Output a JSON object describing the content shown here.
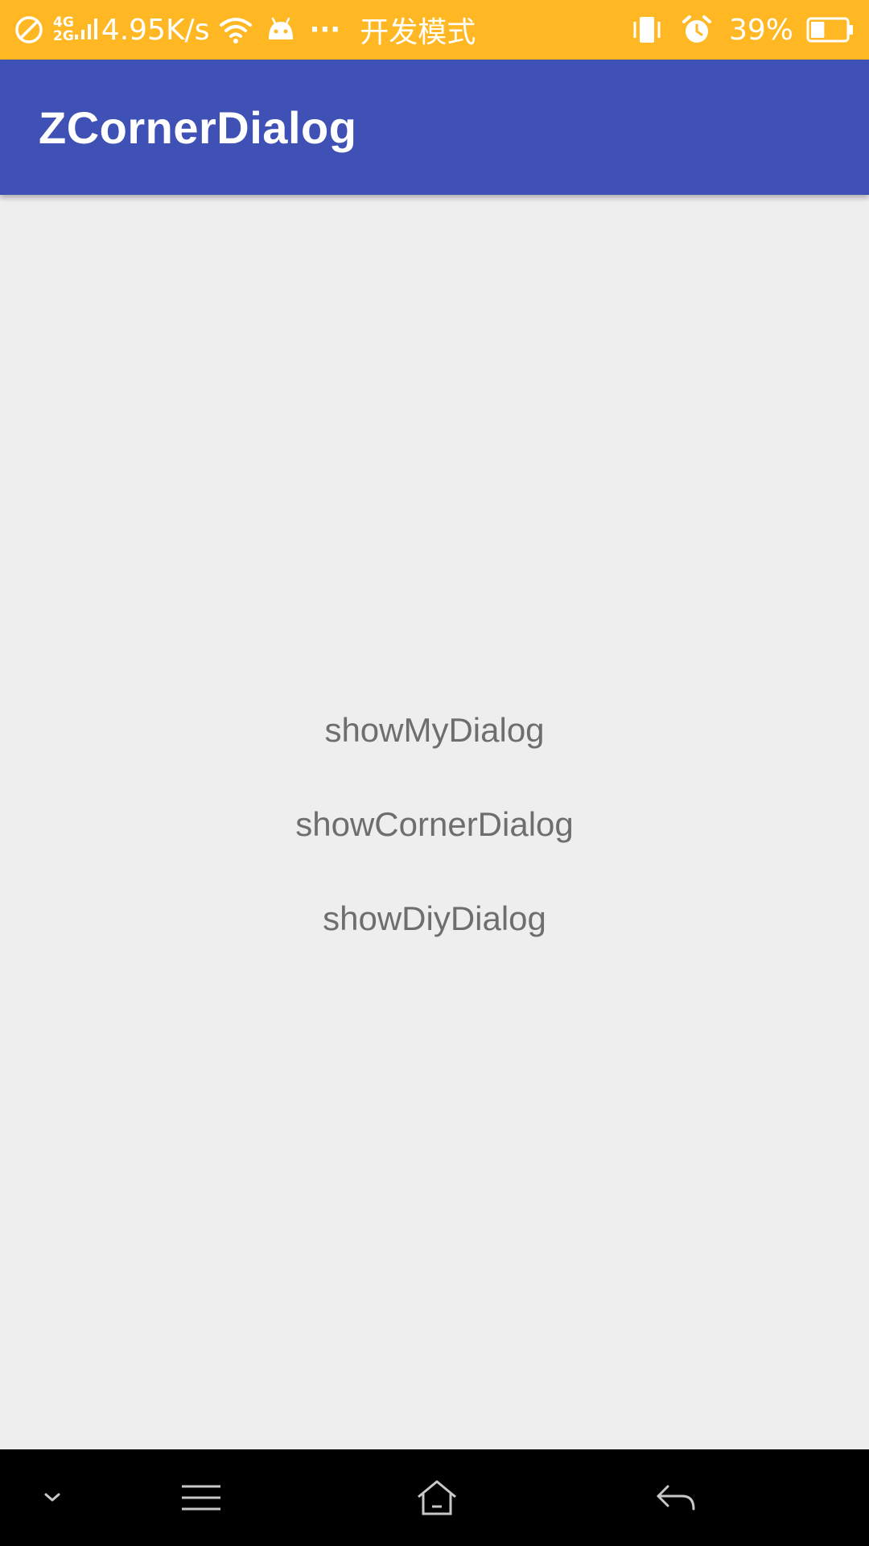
{
  "status_bar": {
    "network_top": "4G",
    "network_bottom": "2G",
    "net_speed": "4.95K/s",
    "more_dots": "···",
    "dev_mode": "开发模式",
    "battery_percent": "39%",
    "battery_level": 0.39,
    "icons": [
      "do-not-disturb-icon",
      "signal-icon",
      "wifi-icon",
      "android-icon",
      "more-icon",
      "vibrate-icon",
      "alarm-icon",
      "battery-icon"
    ]
  },
  "app_bar": {
    "title": "ZCornerDialog"
  },
  "buttons": {
    "show_my_dialog": "showMyDialog",
    "show_corner_dialog": "showCornerDialog",
    "show_diy_dialog": "showDiyDialog"
  },
  "nav_bar": {
    "icons": [
      "chevron-down-icon",
      "menu-icon",
      "home-icon",
      "back-icon"
    ]
  },
  "colors": {
    "status_bar": "#ffb823",
    "app_bar": "#3f51b5",
    "background": "#eeeeee",
    "button_text": "#6e6e6e",
    "nav_bar": "#000000"
  }
}
